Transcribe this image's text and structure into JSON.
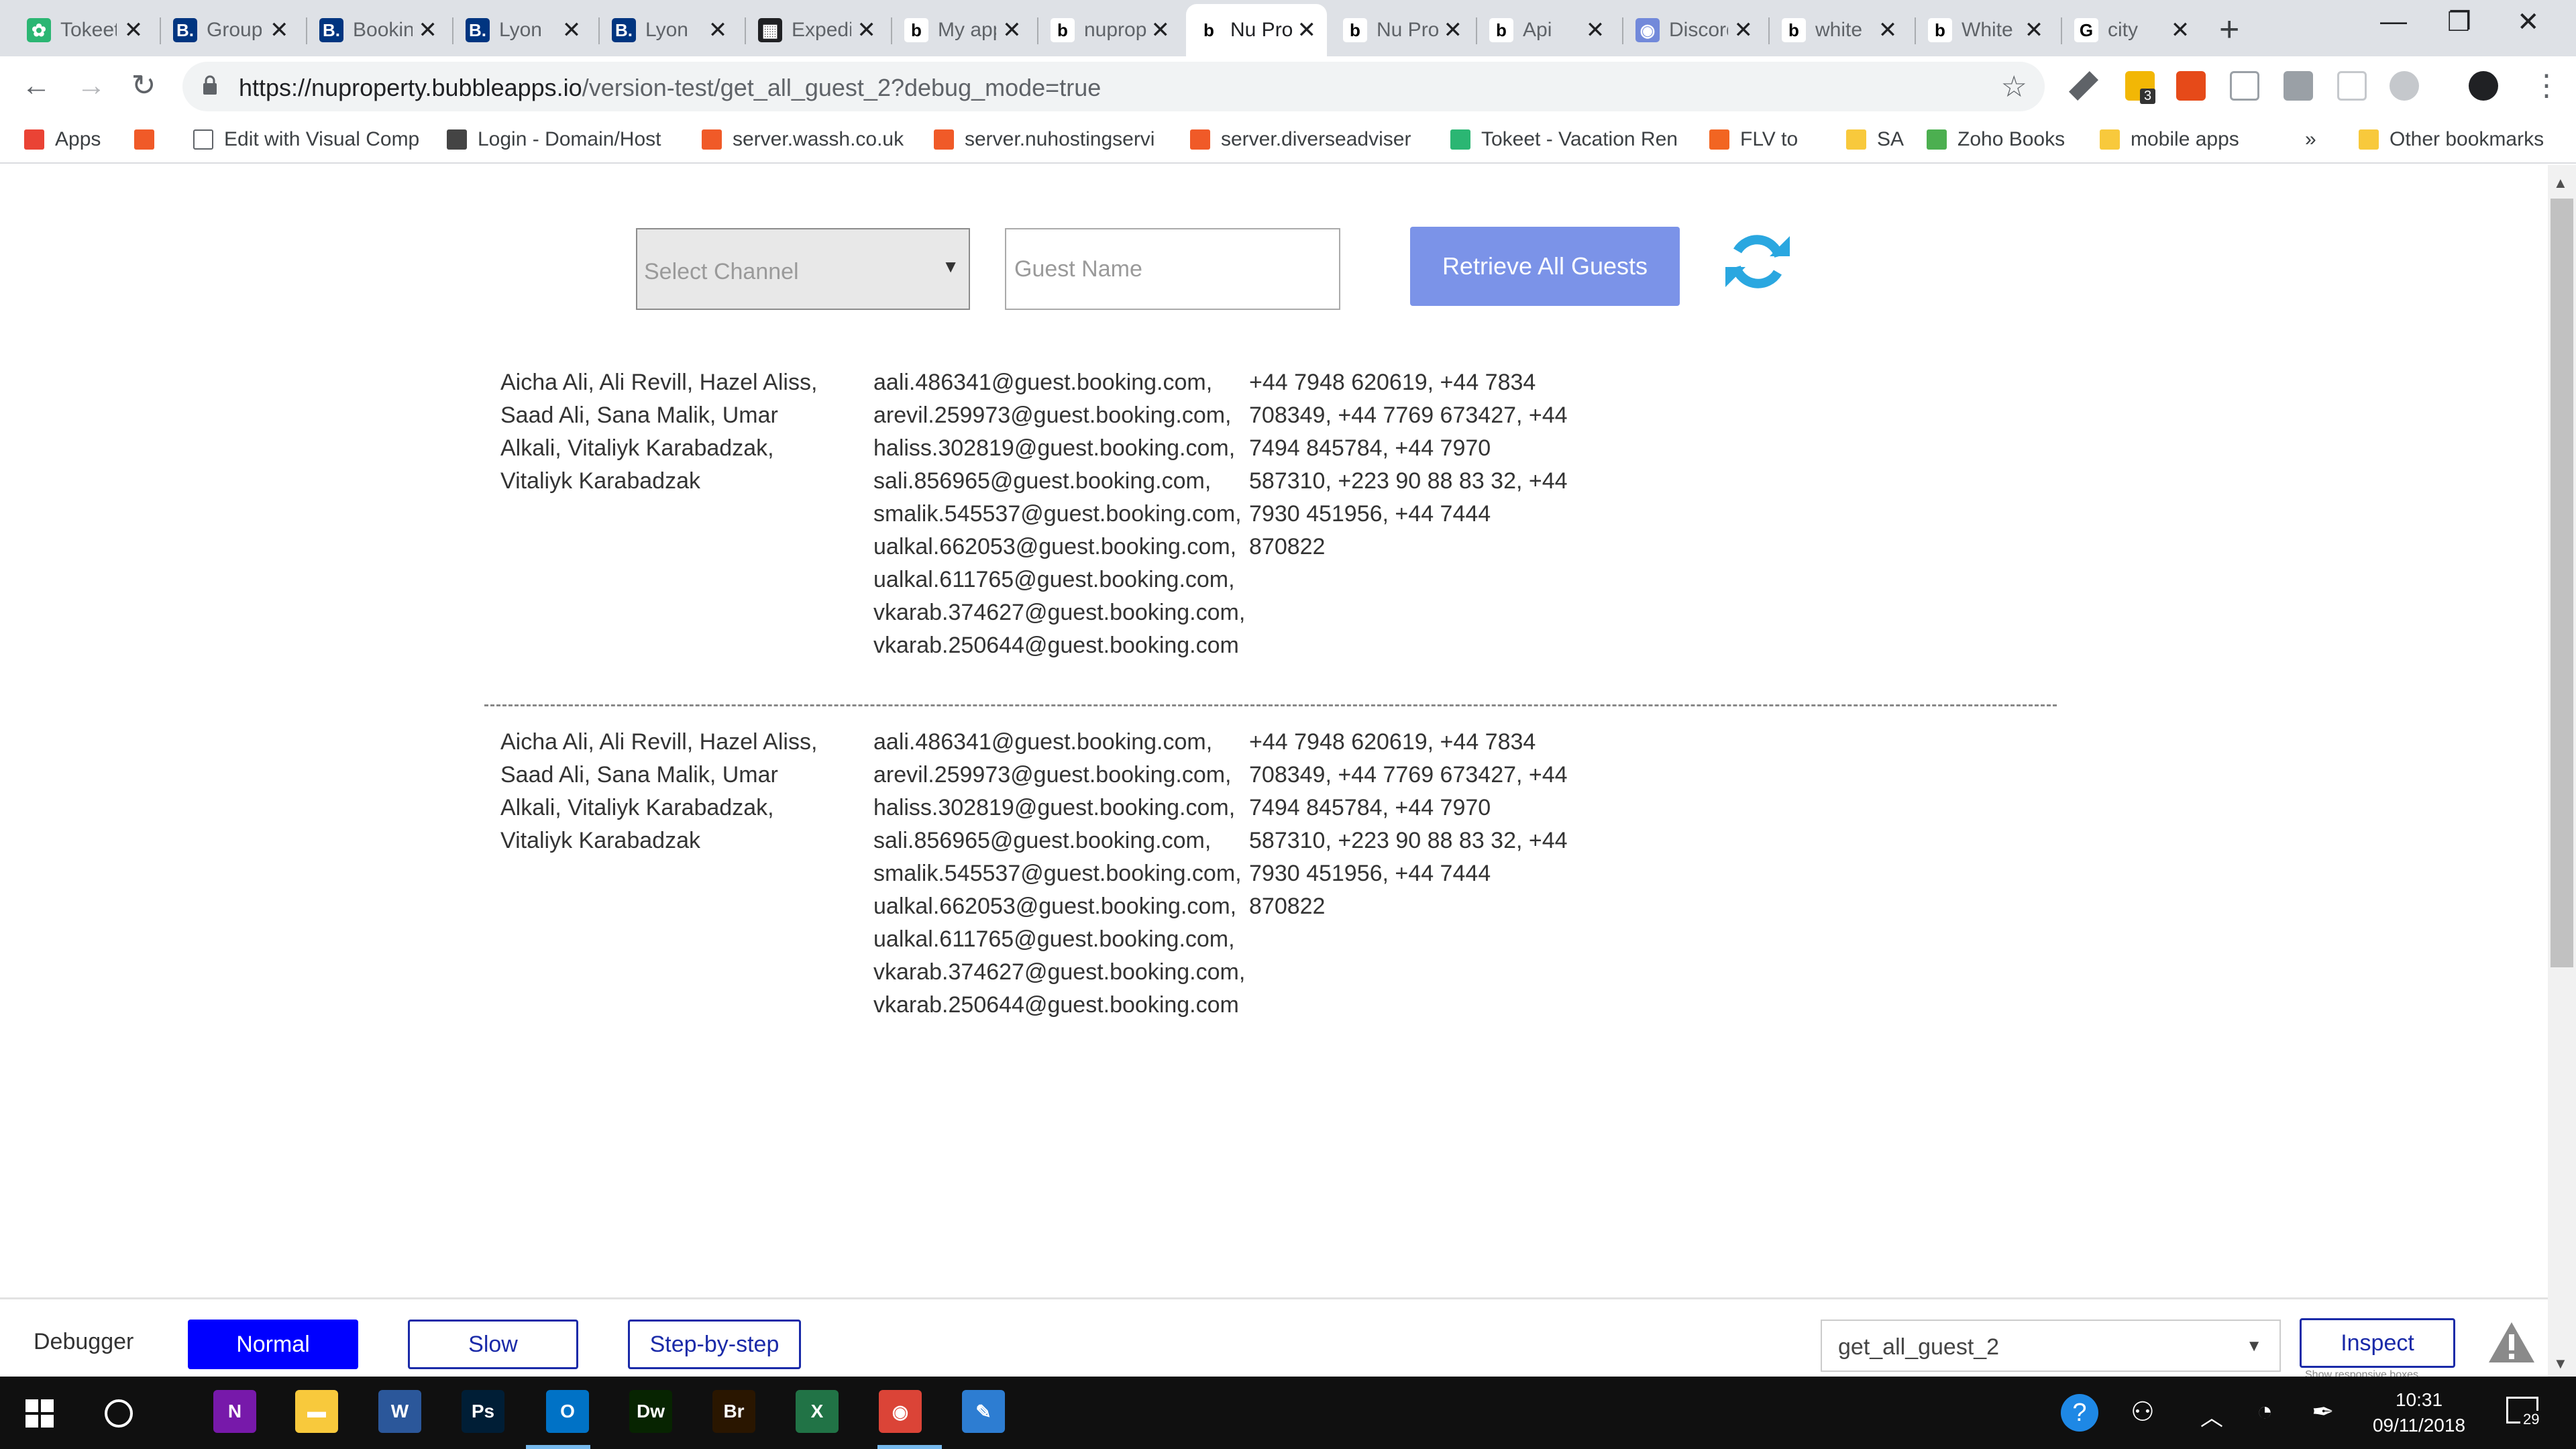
{
  "browser": {
    "tabs": [
      {
        "title": "Tokeet",
        "color": "#2bb673",
        "glyph": "✿"
      },
      {
        "title": "Group",
        "color": "#003580",
        "glyph": "B."
      },
      {
        "title": "Booking",
        "color": "#003580",
        "glyph": "B."
      },
      {
        "title": "Lyon",
        "color": "#003580",
        "glyph": "B."
      },
      {
        "title": "Lyon",
        "color": "#003580",
        "glyph": "B."
      },
      {
        "title": "Expedia",
        "color": "#202124",
        "glyph": "▦"
      },
      {
        "title": "My app",
        "color": "#ffffff",
        "glyph": "b"
      },
      {
        "title": "nuproperty",
        "color": "#ffffff",
        "glyph": "b"
      },
      {
        "title": "Nu Property",
        "color": "#ffffff",
        "glyph": "b"
      },
      {
        "title": "Nu Property",
        "color": "#ffffff",
        "glyph": "b"
      },
      {
        "title": "Api",
        "color": "#ffffff",
        "glyph": "b"
      },
      {
        "title": "Discord",
        "color": "#7289da",
        "glyph": "◉"
      },
      {
        "title": "white",
        "color": "#ffffff",
        "glyph": "b"
      },
      {
        "title": "White",
        "color": "#ffffff",
        "glyph": "b"
      },
      {
        "title": "city",
        "color": "#ffffff",
        "glyph": "G"
      }
    ],
    "active_tab": 8,
    "url_host": "https://nuproperty.bubbleapps.io",
    "url_path": "/version-test/get_all_guest_2?debug_mode=true",
    "extension_badge": "3",
    "bookmarks": [
      "Apps",
      "",
      "Edit with Visual Comp",
      "Login - Domain/Host",
      "server.wassh.co.uk",
      "server.nuhostingservi",
      "server.diverseadviser",
      "Tokeet - Vacation Ren",
      "FLV to",
      "SA",
      "Zoho Books",
      "mobile apps"
    ],
    "bookmarks_overflow": "»",
    "other_bookmarks": "Other bookmarks"
  },
  "page": {
    "channel_select": {
      "placeholder": "Select Channel"
    },
    "guest_name": {
      "placeholder": "Guest Name"
    },
    "retrieve_button": "Retrieve All Guests",
    "rows": [
      {
        "names": [
          "Aicha Ali, Ali Revill, Hazel Aliss,",
          "Saad Ali, Sana Malik, Umar",
          "Alkali, Vitaliyk  Karabadzak,",
          "Vitaliyk Karabadzak"
        ],
        "emails": [
          "aali.486341@guest.booking.com,",
          "arevil.259973@guest.booking.com,",
          "haliss.302819@guest.booking.com,",
          "sali.856965@guest.booking.com,",
          "smalik.545537@guest.booking.com,",
          "ualkal.662053@guest.booking.com,",
          "ualkal.611765@guest.booking.com,",
          "vkarab.374627@guest.booking.com,",
          "vkarab.250644@guest.booking.com"
        ],
        "phones": [
          "+44 7948 620619, +44 7834",
          "708349, +44 7769 673427, +44",
          "7494 845784, +44 7970",
          "587310, +223 90 88 83 32, +44",
          "7930 451956, +44 7444",
          "870822"
        ]
      },
      {
        "names": [
          "Aicha Ali, Ali Revill, Hazel Aliss,",
          "Saad Ali, Sana Malik, Umar",
          "Alkali, Vitaliyk  Karabadzak,",
          "Vitaliyk Karabadzak"
        ],
        "emails": [
          "aali.486341@guest.booking.com,",
          "arevil.259973@guest.booking.com,",
          "haliss.302819@guest.booking.com,",
          "sali.856965@guest.booking.com,",
          "smalik.545537@guest.booking.com,",
          "ualkal.662053@guest.booking.com,",
          "ualkal.611765@guest.booking.com,",
          "vkarab.374627@guest.booking.com,",
          "vkarab.250644@guest.booking.com"
        ],
        "phones": [
          "+44 7948 620619, +44 7834",
          "708349, +44 7769 673427, +44",
          "7494 845784, +44 7970",
          "587310, +223 90 88 83 32, +44",
          "7930 451956, +44 7444",
          "870822"
        ]
      }
    ]
  },
  "debugger": {
    "label": "Debugger",
    "modes": [
      "Normal",
      "Slow",
      "Step-by-step"
    ],
    "selected_mode": "Normal",
    "element_select": "get_all_guest_2",
    "inspect_button": "Inspect",
    "responsive_hint": "Show responsive boxes"
  },
  "taskbar": {
    "time": "10:31",
    "date": "09/11/2018",
    "notification_count": "29",
    "apps": [
      {
        "name": "onenote",
        "glyph": "N",
        "color": "#7719aa"
      },
      {
        "name": "file-explorer",
        "glyph": "▬",
        "color": "#f8c93c"
      },
      {
        "name": "word",
        "glyph": "W",
        "color": "#2b579a"
      },
      {
        "name": "photoshop",
        "glyph": "Ps",
        "color": "#001e36"
      },
      {
        "name": "outlook",
        "glyph": "O",
        "color": "#0072c6"
      },
      {
        "name": "dreamweaver",
        "glyph": "Dw",
        "color": "#072401"
      },
      {
        "name": "bridge",
        "glyph": "Br",
        "color": "#2a1600"
      },
      {
        "name": "excel",
        "glyph": "X",
        "color": "#217346"
      },
      {
        "name": "chrome",
        "glyph": "◉",
        "color": "#db4437"
      },
      {
        "name": "paint",
        "glyph": "✎",
        "color": "#2d7dd2"
      }
    ]
  },
  "colors": {
    "accent_button": "#7b93e8",
    "refresh_icon": "#2aa7e0",
    "debug_selected": "#0000ff",
    "debug_border": "#1a2aa8"
  }
}
